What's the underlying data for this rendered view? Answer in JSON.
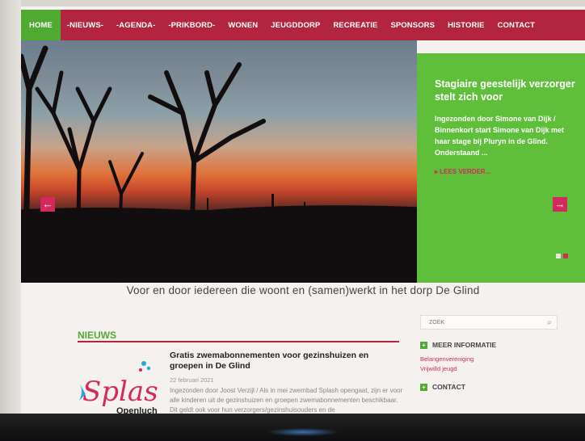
{
  "nav": {
    "items": [
      "HOME",
      "-NIEUWS-",
      "-AGENDA-",
      "-PRIKBORD-",
      "WONEN",
      "JEUGDDORP",
      "RECREATIE",
      "SPONSORS",
      "HISTORIE",
      "CONTACT"
    ]
  },
  "hero": {
    "prev_icon": "arrow-left-icon",
    "next_icon": "arrow-right-icon"
  },
  "feature": {
    "title": "Stagiaire geestelijk verzorger stelt zich voor",
    "text": "Ingezonden door Simone van Dijk / Binnenkort start Simone van Dijk met haar stage bij Pluryn in de Glind. Onderstaand ...",
    "more": "▸ LEES VERDER..."
  },
  "tagline": "Voor en door iedereen die woont en (samen)werkt in het dorp De Glind",
  "news": {
    "heading": "NIEUWS",
    "logo_text": "Splas",
    "logo_sub": "Openluch",
    "article": {
      "title": "Gratis zwemabonnementen voor gezinshuizen en groepen in De Glind",
      "date": "22 februari 2021",
      "excerpt": "Ingezonden door Joost Verzijl / Als in mei zwembad Splash opengaat, zijn er voor alle kinderen uit de gezinshuizen en groepen zwemabonnementen beschikbaar. Dit geldt ook voor hun verzorgers/gezinshuisouders en de"
    }
  },
  "sidebar": {
    "search_placeholder": "ZOEK",
    "meer_info_title": "MEER INFORMATIE",
    "links": [
      "Belangenvereniging",
      "Vrijwilld jeugd"
    ],
    "contact_title": "CONTACT"
  },
  "colors": {
    "nav_bg": "#b3243e",
    "accent_green": "#4faa32",
    "link_pink": "#d22a5f"
  }
}
